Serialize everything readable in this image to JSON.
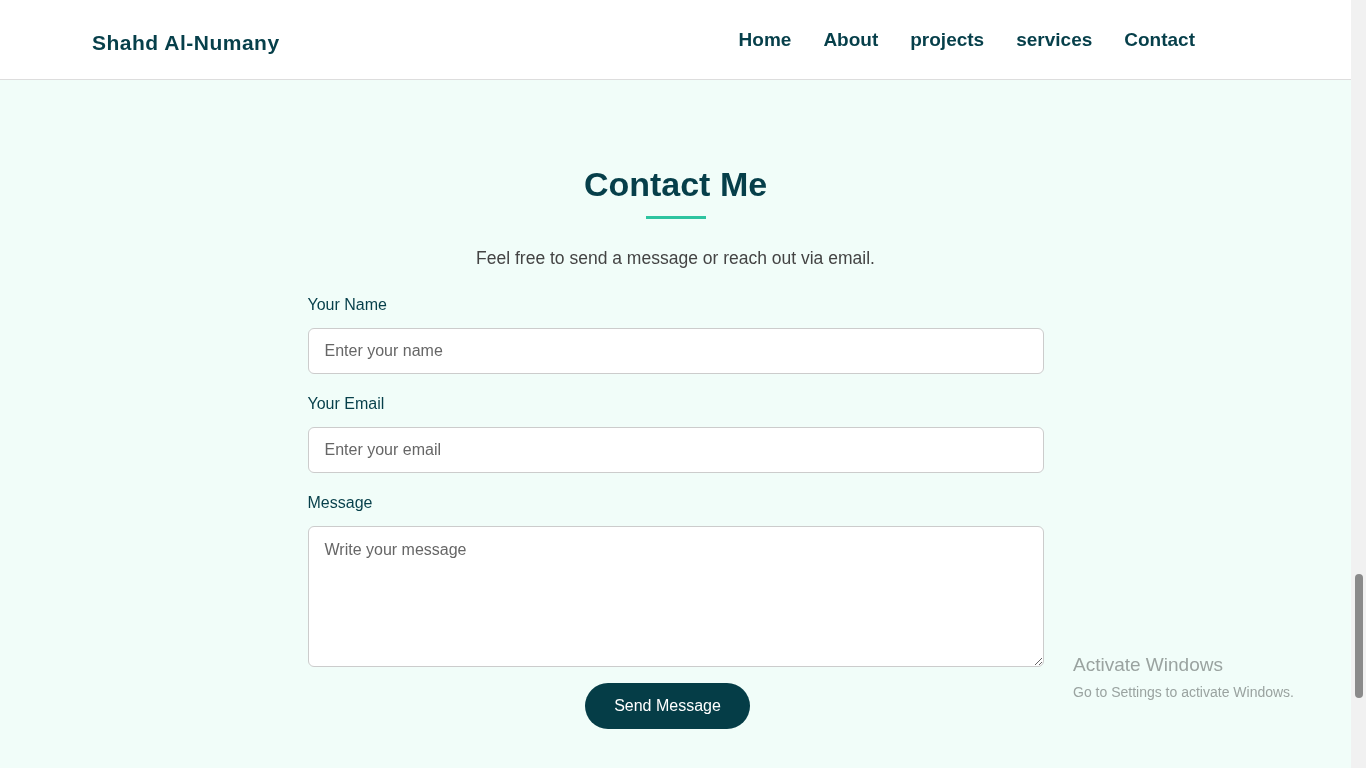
{
  "header": {
    "logo": "Shahd Al-Numany",
    "nav": [
      {
        "label": "Home"
      },
      {
        "label": "About"
      },
      {
        "label": "projects"
      },
      {
        "label": "services"
      },
      {
        "label": "Contact"
      }
    ]
  },
  "contact": {
    "title": "Contact Me",
    "subtitle": "Feel free to send a message or reach out via email.",
    "fields": [
      {
        "kind": "input",
        "label": "Your Name",
        "placeholder": "Enter your name"
      },
      {
        "kind": "input",
        "label": "Your Email",
        "placeholder": "Enter your email"
      },
      {
        "kind": "textarea",
        "label": "Message",
        "placeholder": "Write your message"
      }
    ],
    "button": "Send Message"
  },
  "os_overlay": {
    "title": "Activate Windows",
    "text": "Go to Settings to activate Windows."
  }
}
